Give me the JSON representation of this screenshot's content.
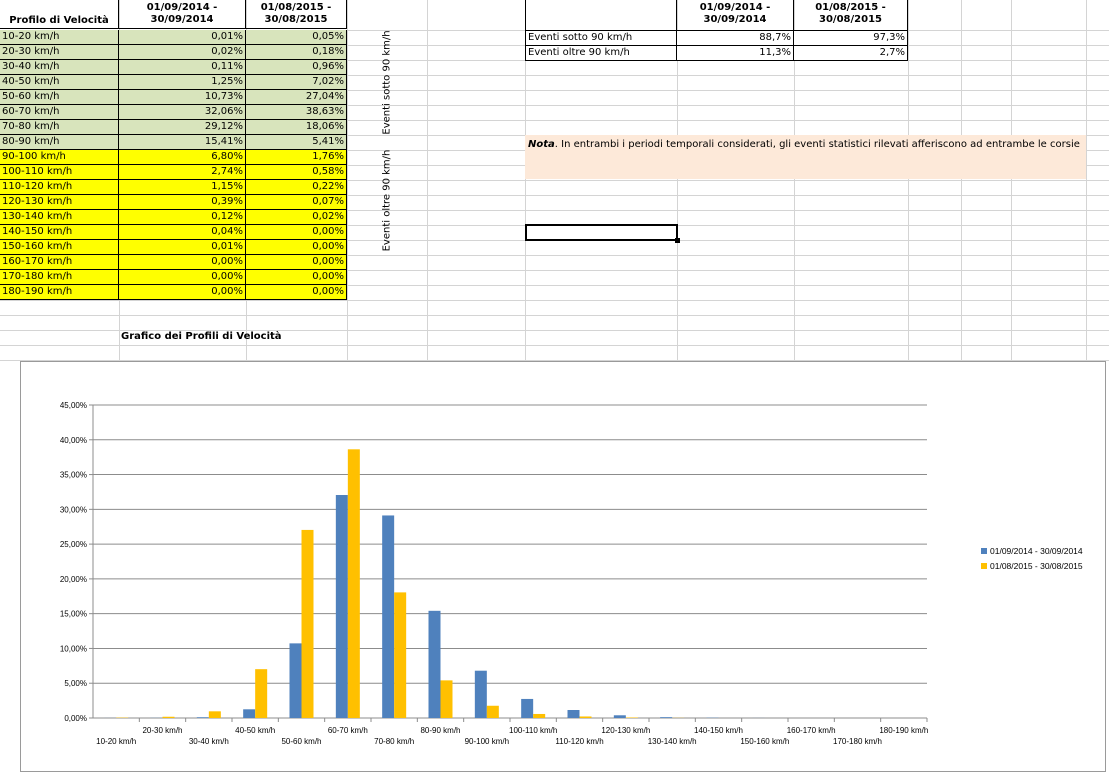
{
  "speed_table": {
    "header_label": "Profilo di Velocità",
    "col1_label": "01/09/2014 - 30/09/2014",
    "col1_line1": "01/09/2014 -",
    "col1_line2": "30/09/2014",
    "col2_line1": "01/08/2015 -",
    "col2_line2": "30/08/2015",
    "rows": [
      {
        "range": "10-20 km/h",
        "v2014": "0,01%",
        "v2015": "0,05%"
      },
      {
        "range": "20-30 km/h",
        "v2014": "0,02%",
        "v2015": "0,18%"
      },
      {
        "range": "30-40 km/h",
        "v2014": "0,11%",
        "v2015": "0,96%"
      },
      {
        "range": "40-50 km/h",
        "v2014": "1,25%",
        "v2015": "7,02%"
      },
      {
        "range": "50-60 km/h",
        "v2014": "10,73%",
        "v2015": "27,04%"
      },
      {
        "range": "60-70 km/h",
        "v2014": "32,06%",
        "v2015": "38,63%"
      },
      {
        "range": "70-80 km/h",
        "v2014": "29,12%",
        "v2015": "18,06%"
      },
      {
        "range": "80-90 km/h",
        "v2014": "15,41%",
        "v2015": "5,41%"
      },
      {
        "range": "90-100 km/h",
        "v2014": "6,80%",
        "v2015": "1,76%"
      },
      {
        "range": "100-110 km/h",
        "v2014": "2,74%",
        "v2015": "0,58%"
      },
      {
        "range": "110-120 km/h",
        "v2014": "1,15%",
        "v2015": "0,22%"
      },
      {
        "range": "120-130 km/h",
        "v2014": "0,39%",
        "v2015": "0,07%"
      },
      {
        "range": "130-140 km/h",
        "v2014": "0,12%",
        "v2015": "0,02%"
      },
      {
        "range": "140-150 km/h",
        "v2014": "0,04%",
        "v2015": "0,00%"
      },
      {
        "range": "150-160 km/h",
        "v2014": "0,01%",
        "v2015": "0,00%"
      },
      {
        "range": "160-170 km/h",
        "v2014": "0,00%",
        "v2015": "0,00%"
      },
      {
        "range": "170-180 km/h",
        "v2014": "0,00%",
        "v2015": "0,00%"
      },
      {
        "range": "180-190 km/h",
        "v2014": "0,00%",
        "v2015": "0,00%"
      }
    ],
    "group_below_label": "Eventi sotto 90 km/h",
    "group_above_label": "Eventi oltre 90 km/h"
  },
  "summary_table": {
    "col1_line1": "01/09/2014 -",
    "col1_line2": "30/09/2014",
    "col2_line1": "01/08/2015 -",
    "col2_line2": "30/08/2015",
    "rows": [
      {
        "label": "Eventi sotto 90 km/h",
        "v2014": "88,7%",
        "v2015": "97,3%"
      },
      {
        "label": "Eventi oltre 90 km/h",
        "v2014": "11,3%",
        "v2015": "2,7%"
      }
    ]
  },
  "note": {
    "bold_label": "Nota",
    "text": ". In entrambi i periodi temporali considerati, gli eventi statistici rilevati afferiscono ad entrambe le corsie"
  },
  "chart_section_title": "Grafico dei Profili di Velocità",
  "colors": {
    "green_fill": "#d8e4bc",
    "yellow_fill": "#ffff00",
    "note_fill": "#fde9d9",
    "series_2014": "#4f81bd",
    "series_2015": "#ffc000"
  },
  "chart_data": {
    "type": "bar",
    "title": "",
    "xlabel": "",
    "ylabel": "",
    "categories": [
      "10-20 km/h",
      "20-30 km/h",
      "30-40 km/h",
      "40-50 km/h",
      "50-60 km/h",
      "60-70 km/h",
      "70-80 km/h",
      "80-90 km/h",
      "90-100 km/h",
      "100-110 km/h",
      "110-120 km/h",
      "120-130 km/h",
      "130-140 km/h",
      "140-150 km/h",
      "150-160 km/h",
      "160-170 km/h",
      "170-180 km/h",
      "180-190 km/h"
    ],
    "series": [
      {
        "name": "01/09/2014 - 30/09/2014",
        "values": [
          0.01,
          0.02,
          0.11,
          1.25,
          10.73,
          32.06,
          29.12,
          15.41,
          6.8,
          2.74,
          1.15,
          0.39,
          0.12,
          0.04,
          0.01,
          0.0,
          0.0,
          0.0
        ]
      },
      {
        "name": "01/08/2015 - 30/08/2015",
        "values": [
          0.05,
          0.18,
          0.96,
          7.02,
          27.04,
          38.63,
          18.06,
          5.41,
          1.76,
          0.58,
          0.22,
          0.07,
          0.02,
          0.0,
          0.0,
          0.0,
          0.0,
          0.0
        ]
      }
    ],
    "ylim": [
      0,
      45
    ],
    "yticks": [
      "0,00%",
      "5,00%",
      "10,00%",
      "15,00%",
      "20,00%",
      "25,00%",
      "30,00%",
      "35,00%",
      "40,00%",
      "45,00%"
    ],
    "grid": true,
    "legend_position": "right"
  }
}
